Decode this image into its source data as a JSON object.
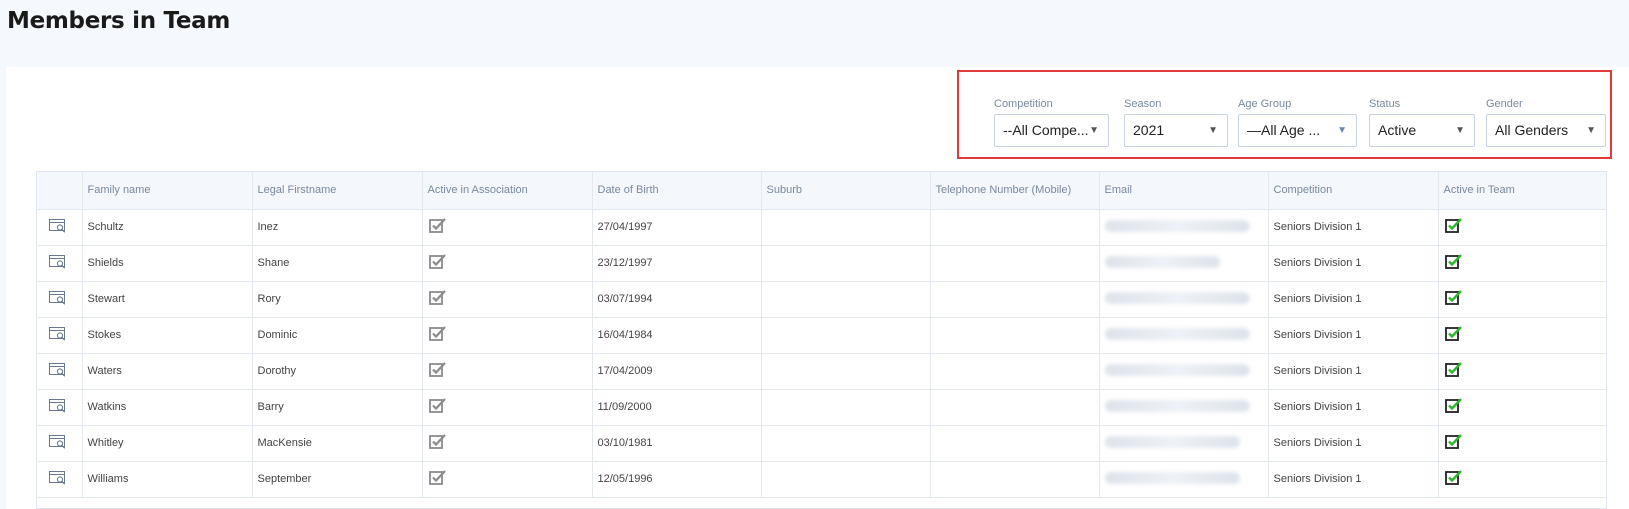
{
  "page": {
    "title": "Members in Team"
  },
  "filters": [
    {
      "label": "Competition",
      "value": "--All Compe..."
    },
    {
      "label": "Season",
      "value": "2021"
    },
    {
      "label": "Age Group",
      "value": "—All Age ..."
    },
    {
      "label": "Status",
      "value": "Active"
    },
    {
      "label": "Gender",
      "value": "All Genders"
    }
  ],
  "table": {
    "columns": [
      "",
      "Family name",
      "Legal Firstname",
      "Active in Association",
      "Date of Birth",
      "Suburb",
      "Telephone Number (Mobile)",
      "Email",
      "Competition",
      "Active in Team"
    ],
    "rows": [
      {
        "family": "Schultz",
        "first": "Inez",
        "dob": "27/04/1997",
        "competition": "Seniors Division 1"
      },
      {
        "family": "Shields",
        "first": "Shane",
        "dob": "23/12/1997",
        "competition": "Seniors Division 1"
      },
      {
        "family": "Stewart",
        "first": "Rory",
        "dob": "03/07/1994",
        "competition": "Seniors Division 1"
      },
      {
        "family": "Stokes",
        "first": "Dominic",
        "dob": "16/04/1984",
        "competition": "Seniors Division 1"
      },
      {
        "family": "Waters",
        "first": "Dorothy",
        "dob": "17/04/2009",
        "competition": "Seniors Division 1"
      },
      {
        "family": "Watkins",
        "first": "Barry",
        "dob": "11/09/2000",
        "competition": "Seniors Division 1"
      },
      {
        "family": "Whitley",
        "first": "MacKensie",
        "dob": "03/10/1981",
        "competition": "Seniors Division 1"
      },
      {
        "family": "Williams",
        "first": "September",
        "dob": "12/05/1996",
        "competition": "Seniors Division 1"
      }
    ]
  },
  "colors": {
    "highlight": "#e23a3a",
    "check_green": "#2db52d"
  },
  "icons": {
    "view": "view-details-icon",
    "active_assoc": "checkbox-checked-grey-icon",
    "active_team": "checkbox-checked-green-icon"
  }
}
